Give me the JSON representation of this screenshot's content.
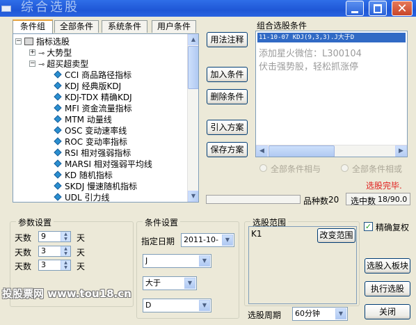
{
  "window": {
    "title": "综合选股"
  },
  "tabs": [
    "条件组",
    "全部条件",
    "系统条件",
    "用户条件"
  ],
  "tree": {
    "root": "指标选股",
    "groups": [
      "大势型",
      "超买超卖型"
    ],
    "items": [
      "CCI 商品路径指标",
      "KDJ 经典版KDJ",
      "KDJ-TDX 精确KDJ",
      "MFI 资金流量指标",
      "MTM 动量线",
      "OSC 变动速率线",
      "ROC 变动率指标",
      "RSI 相对强弱指标",
      "MARSI 相对强弱平均线",
      "KD 随机指标",
      "SKDJ 慢速随机指标",
      "UDL 引力线"
    ]
  },
  "mid_buttons": {
    "usage": "用法注释",
    "add": "加入条件",
    "delete": "删除条件",
    "import": "引入方案",
    "save": "保存方案"
  },
  "conditions": {
    "title": "组合选股条件",
    "selected": "11-10-07 KDJ(9,3,3).J大于D",
    "ad_line1": "添加星火微信：L300104",
    "ad_line2": "伏击强势股，轻松抓涨停"
  },
  "options": {
    "all_and": "全部条件相与",
    "all_or": "全部条件相或"
  },
  "status": {
    "done": "选股完毕.",
    "count_label": "品种数",
    "count": "20",
    "selected_label": "选中数",
    "selected": "18/90.0"
  },
  "params": {
    "title": "参数设置",
    "rows": [
      {
        "label": "天数",
        "value": "9",
        "unit": "天"
      },
      {
        "label": "天数",
        "value": "3",
        "unit": "天"
      },
      {
        "label": "天数",
        "value": "3",
        "unit": "天"
      }
    ]
  },
  "cond_settings": {
    "title": "条件设置",
    "date_label": "指定日期",
    "date_value": "2011-10-",
    "combo1": "J",
    "combo2": "大于",
    "combo3": "D"
  },
  "range": {
    "title": "选股范围",
    "value": "K1",
    "change_button": "改变范围"
  },
  "period": {
    "label": "选股周期",
    "value": "60分钟"
  },
  "right_panel": {
    "exact_restore": "精确复权",
    "exact_checked": true,
    "to_block": "选股入板块",
    "run": "执行选股",
    "close": "关闭"
  },
  "watermark": "投股票网 www.tou18.cn",
  "colors": {
    "titlebar": "#1f57d6",
    "highlight": "#316ac5",
    "done_text": "#e0201e",
    "close_button": "#c8452a"
  }
}
